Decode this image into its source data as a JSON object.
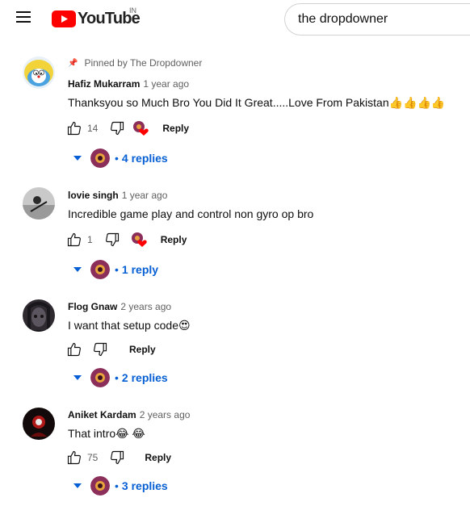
{
  "header": {
    "logo_text": "YouTube",
    "country": "IN",
    "search_value": "the dropdowner"
  },
  "comments": [
    {
      "pinned": "Pinned by The Dropdowner",
      "author": "Hafiz Mukarram",
      "time": "1 year ago",
      "text": "Thanksyou so Much Bro You Did  It Great.....Love From Pakistan👍👍👍👍",
      "likes": "14",
      "reply_label": "Reply",
      "replies": "4 replies"
    },
    {
      "author": "lovie singh",
      "time": "1 year ago",
      "text": "Incredible game play and control non gyro op bro",
      "likes": "1",
      "reply_label": "Reply",
      "replies": "1 reply"
    },
    {
      "author": "Flog Gnaw",
      "time": "2 years ago",
      "text": "I want that setup code😍",
      "likes": "",
      "reply_label": "Reply",
      "replies": "2 replies"
    },
    {
      "author": "Aniket Kardam",
      "time": "2 years ago",
      "text": "That intro😂 😂",
      "likes": "75",
      "reply_label": "Reply",
      "replies": "3 replies"
    }
  ],
  "colors": {
    "link": "#065fd4",
    "brand_red": "#ff0000",
    "heart": "#ff0000"
  }
}
